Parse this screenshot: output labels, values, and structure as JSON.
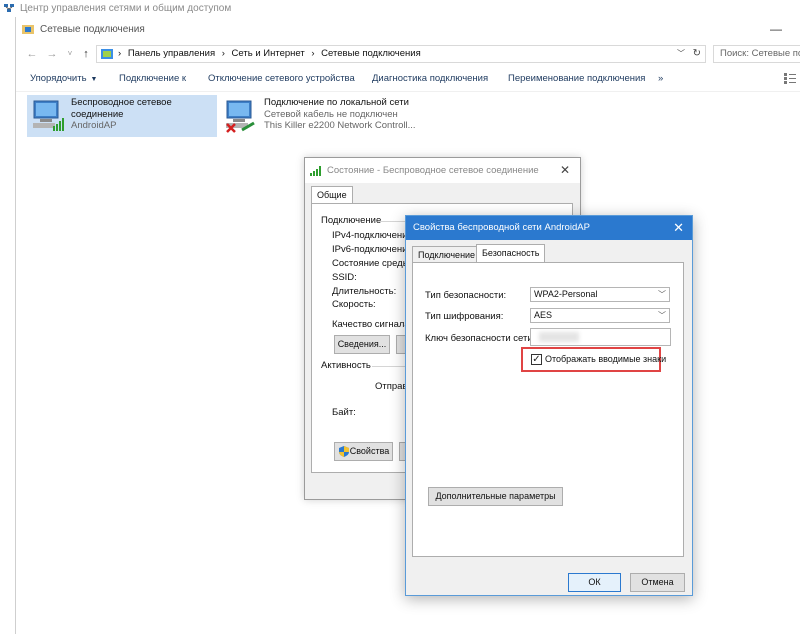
{
  "background_window": {
    "title": "Центр управления сетями и общим доступом"
  },
  "main_window": {
    "title": "Сетевые подключения",
    "address": {
      "breadcrumbs": [
        "Панель управления",
        "Сеть и Интернет",
        "Сетевые подключения"
      ],
      "search_placeholder": "Поиск: Сетевые подключения"
    },
    "commands": [
      "Упорядочить",
      "Подключение к",
      "Отключение сетевого устройства",
      "Диагностика подключения",
      "Переименование подключения"
    ],
    "more_label": "»",
    "connections": [
      {
        "name": "Беспроводное сетевое",
        "name2": "соединение",
        "detail": "AndroidAP"
      },
      {
        "name": "Подключение по локальной сети",
        "status": "Сетевой кабель не подключен",
        "adapter": "This Killer e2200 Network Controll..."
      }
    ]
  },
  "status_dialog": {
    "title": "Состояние - Беспроводное сетевое соединение",
    "tab": "Общие",
    "connection_group": "Подключение",
    "rows": [
      "IPv4-подключение",
      "IPv6-подключение",
      "Состояние среды:",
      "SSID:",
      "Длительность:",
      "Скорость:"
    ],
    "signal_quality": "Качество сигнала:",
    "details_button": "Сведения...",
    "activity_group": "Активность",
    "sent": "Отправ",
    "bytes": "Байт:",
    "properties_button": "Свойства"
  },
  "properties_dialog": {
    "title": "Свойства беспроводной сети AndroidAP",
    "tabs": [
      "Подключение",
      "Безопасность"
    ],
    "security_type_label": "Тип безопасности:",
    "security_type_value": "WPA2-Personal",
    "encryption_type_label": "Тип шифрования:",
    "encryption_type_value": "AES",
    "key_label": "Ключ безопасности сети",
    "show_chars_label": "Отображать вводимые знаки",
    "show_chars_checked": true,
    "advanced_button": "Дополнительные параметры",
    "ok_button": "ОК",
    "cancel_button": "Отмена"
  },
  "colors": {
    "accent": "#2b79cf",
    "selection": "#cce0f5",
    "highlight": "#e04444"
  }
}
